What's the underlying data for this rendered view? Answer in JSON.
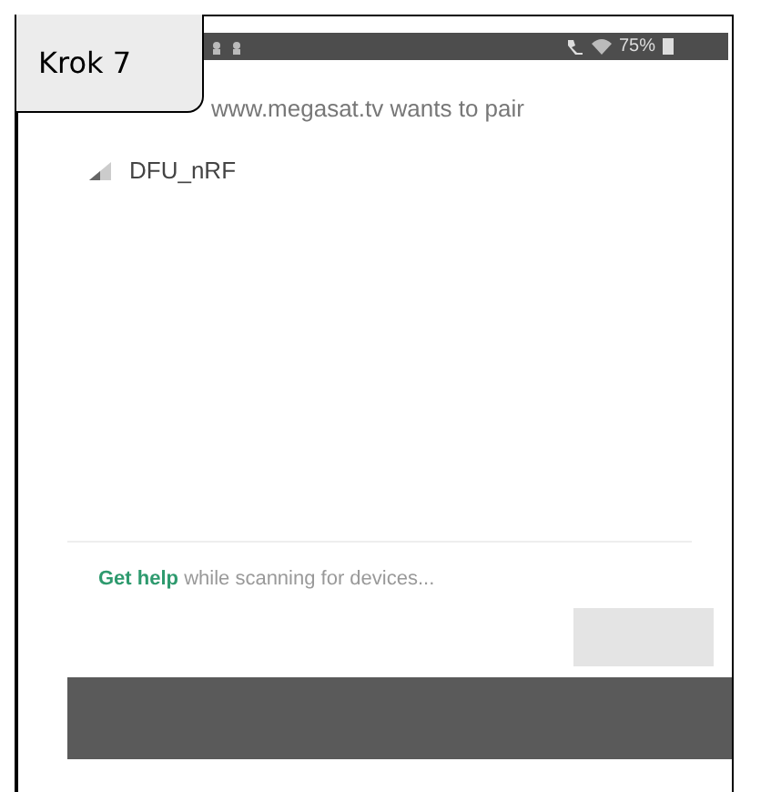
{
  "step_label": "Krok 7",
  "status_bar": {
    "battery": "75%"
  },
  "dialog": {
    "title": "www.megasat.tv wants to pair",
    "devices": [
      {
        "name": "DFU_nRF",
        "selected": false
      }
    ],
    "help": {
      "link": "Get help",
      "text": " while scanning for devices..."
    },
    "pair_button": {
      "disabled": true
    }
  }
}
